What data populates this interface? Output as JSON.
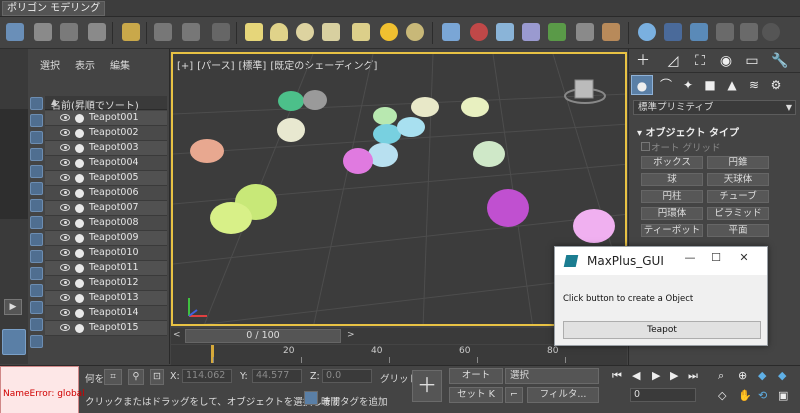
{
  "ribbon": {
    "tab_label": "ポリゴン モデリング"
  },
  "explorer": {
    "menu": {
      "select": "選択",
      "display": "表示",
      "edit": "編集"
    },
    "header": "名前(昇順でソート)",
    "sort_arrow": "▲",
    "items": [
      "Teapot001",
      "Teapot002",
      "Teapot003",
      "Teapot004",
      "Teapot005",
      "Teapot006",
      "Teapot007",
      "Teapot008",
      "Teapot009",
      "Teapot010",
      "Teapot011",
      "Teapot012",
      "Teapot013",
      "Teapot014",
      "Teapot015"
    ]
  },
  "viewport": {
    "label_plus": "[+]",
    "label_view": "[パース]",
    "label_mode": "[標準]",
    "label_shading": "[既定のシェーディング]"
  },
  "timeline": {
    "position": "0 / 100",
    "prev": "<",
    "next": ">",
    "ticks": [
      "0",
      "20",
      "40",
      "60",
      "80"
    ]
  },
  "command_panel": {
    "dropdown": "標準プリミティブ",
    "rollout_title": "オブジェクト タイプ",
    "autogrid": "オート グリッド",
    "buttons": [
      "ボックス",
      "円錐",
      "球",
      "天球体",
      "円柱",
      "チューブ",
      "円環体",
      "ピラミッド",
      "ティーポット",
      "平面"
    ]
  },
  "dialog": {
    "title": "MaxPlus_GUI",
    "message": "Click button to create a Object",
    "button": "Teapot",
    "minimize": "—",
    "maximize": "☐",
    "close": "✕"
  },
  "status": {
    "error": "NameError: global",
    "prompt": "クリックまたはドラッグをして、オブジェクトを選択します",
    "x_label": "X:",
    "x_value": "114.062",
    "y_label": "Y:",
    "y_value": "44.577",
    "z_label": "Z:",
    "z_value": "0.0",
    "grid_label": "グリッド",
    "auto_button": "オート",
    "set_key_button": "セット K",
    "selection": "選択",
    "filter_button": "フィルタ...",
    "time_tag": "時間タグを追加",
    "frame_value": "0",
    "obj_label": "何を"
  },
  "colors": {
    "viewport_border": "#e8c244",
    "dialog_icon": "#1b7d91",
    "error_text": "#d00000"
  }
}
